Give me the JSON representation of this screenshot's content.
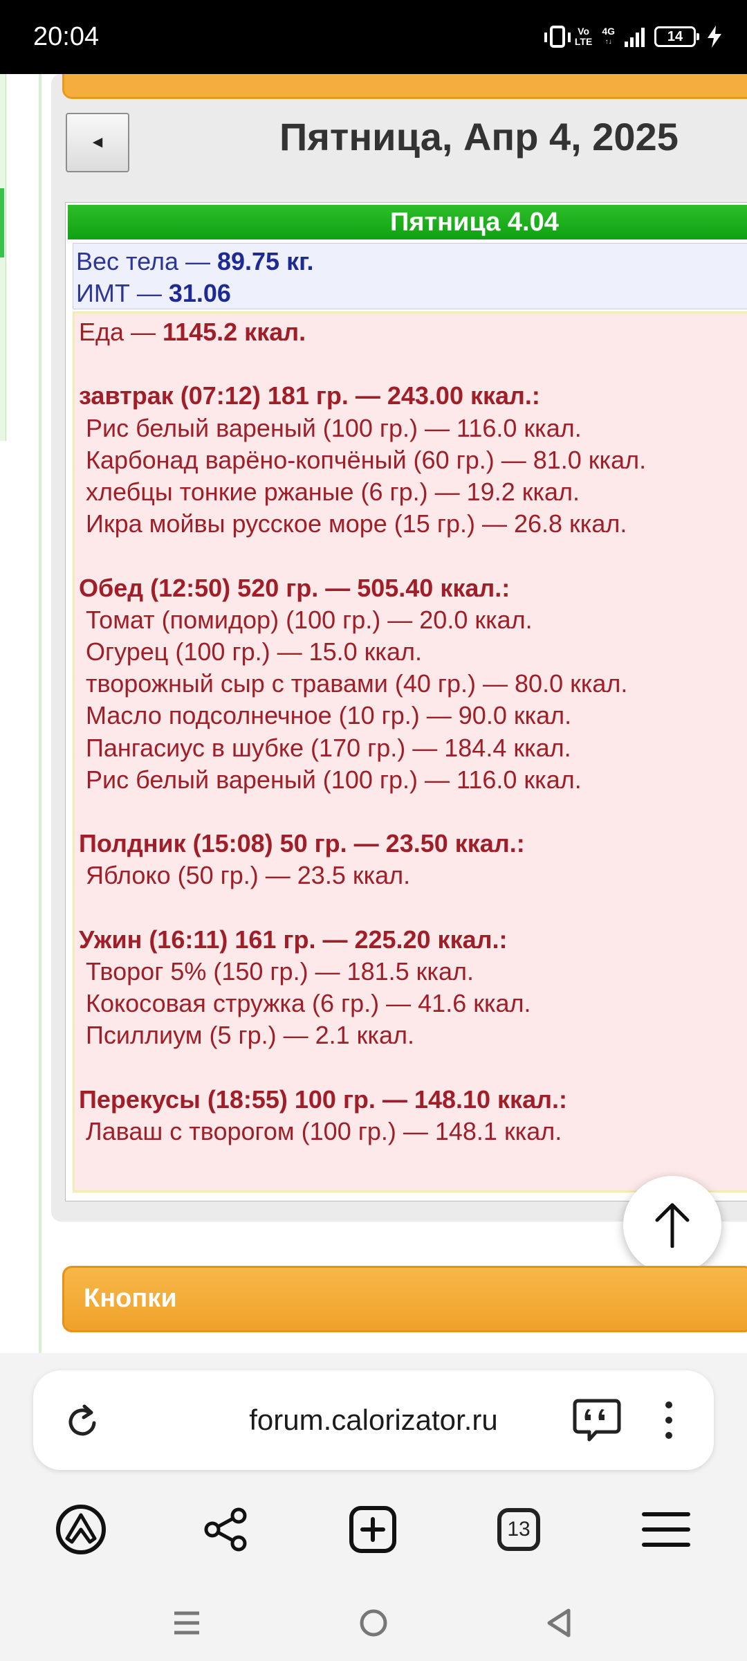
{
  "status_bar": {
    "time": "20:04",
    "network_volte": "Vo\nLTE",
    "network_type": "4G",
    "battery": "14",
    "icons": [
      "vibrate-icon",
      "volte-icon",
      "signal-icon",
      "battery-icon",
      "charging-icon"
    ]
  },
  "page": {
    "nav_back_label": "◄",
    "date_title": "Пятница, Апр 4, 2025",
    "card_header": "Пятница 4.04",
    "body_stats": {
      "weight_label": "Вес тела — ",
      "weight_value": "89.75 кг.",
      "bmi_label": "ИМТ — ",
      "bmi_value": "31.06"
    },
    "food_total_label": "Еда — ",
    "food_total_value": "1145.2 ккал.",
    "meals": [
      {
        "header": "завтрак (07:12) 181 гр. — 243.00 ккал.:",
        "items": [
          "Рис белый вареный (100 гр.) — 116.0 ккал.",
          "Карбонад варёно-копчёный (60 гр.) — 81.0 ккал.",
          "хлебцы тонкие ржаные (6 гр.) — 19.2 ккал.",
          "Икра мойвы русское море (15 гр.) — 26.8 ккал."
        ]
      },
      {
        "header": "Обед (12:50) 520 гр. — 505.40 ккал.:",
        "items": [
          "Томат (помидор) (100 гр.) — 20.0 ккал.",
          "Огурец (100 гр.) — 15.0 ккал.",
          "творожный сыр с травами (40 гр.) — 80.0 ккал.",
          "Масло подсолнечное (10 гр.) — 90.0 ккал.",
          "Пангасиус в шубке (170 гр.) — 184.4 ккал.",
          "Рис белый вареный (100 гр.) — 116.0 ккал."
        ]
      },
      {
        "header": "Полдник (15:08) 50 гр. — 23.50 ккал.:",
        "items": [
          "Яблоко (50 гр.) — 23.5 ккал."
        ]
      },
      {
        "header": "Ужин (16:11) 161 гр. — 225.20 ккал.:",
        "items": [
          "Творог 5% (150 гр.) — 181.5 ккал.",
          "Кокосовая стружка (6 гр.) — 41.6 ккал.",
          "Псиллиум (5 гр.) — 2.1 ккал."
        ]
      },
      {
        "header": "Перекусы (18:55) 100 гр. — 148.10 ккал.:",
        "items": [
          "Лаваш с творогом (100 гр.) — 148.1 ккал."
        ]
      }
    ],
    "buttons_section_label": "Кнопки"
  },
  "browser": {
    "url": "forum.calorizator.ru",
    "tab_count": "13",
    "toolbar_icons": [
      "alice-icon",
      "share-icon",
      "new-tab-icon",
      "tabs-icon",
      "menu-icon"
    ]
  },
  "colors": {
    "header_green": "#0ea112",
    "section_orange": "#f0a22a",
    "meal_text": "#a01e28",
    "stats_text": "#1e2a94",
    "food_bg": "#fde9e9"
  }
}
